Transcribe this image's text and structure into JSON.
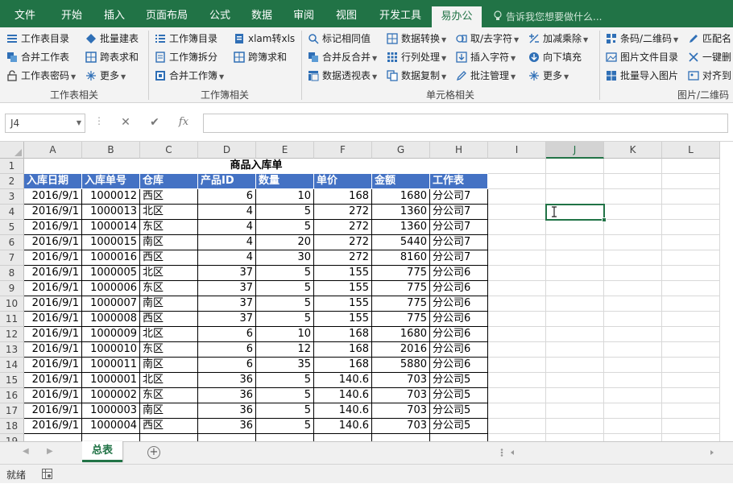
{
  "tabs": [
    "文件",
    "开始",
    "插入",
    "页面布局",
    "公式",
    "数据",
    "审阅",
    "视图",
    "开发工具",
    "易办公"
  ],
  "active_tab_index": 9,
  "tell_me": "告诉我您想要做什么...",
  "ribbon": {
    "group1": {
      "label": "工作表相关",
      "items": [
        "工作表目录",
        "批量建表",
        "合并工作表",
        "跨表求和",
        "工作表密码",
        "更多"
      ]
    },
    "group2": {
      "label": "工作簿相关",
      "items": [
        "工作簿目录",
        "xlam转xls",
        "工作簿拆分",
        "跨簿求和",
        "合并工作簿"
      ]
    },
    "group3": {
      "label": "单元格相关",
      "items": [
        "标记相同值",
        "数据转换",
        "取/去字符",
        "加减乘除",
        "合并反合并",
        "行列处理",
        "插入字符",
        "向下填充",
        "数据透视表",
        "数据复制",
        "批注管理",
        "更多"
      ]
    },
    "group4": {
      "label": "图片/二维码",
      "items": [
        "条码/二维码",
        "匹配名",
        "图片文件目录",
        "一键删",
        "批量导入图片",
        "对齐到"
      ]
    }
  },
  "formula_bar": {
    "name_box": "J4",
    "formula": ""
  },
  "columns": [
    "A",
    "B",
    "C",
    "D",
    "E",
    "F",
    "G",
    "H",
    "I",
    "J",
    "K",
    "L"
  ],
  "selected_column": "J",
  "title": "商品入库单",
  "headers": [
    "入库日期",
    "入库单号",
    "仓库",
    "产品ID",
    "数量",
    "单价",
    "金额",
    "工作表"
  ],
  "rows": [
    [
      "2016/9/1",
      "1000012",
      "西区",
      "6",
      "10",
      "168",
      "1680",
      "分公司7"
    ],
    [
      "2016/9/1",
      "1000013",
      "北区",
      "4",
      "5",
      "272",
      "1360",
      "分公司7"
    ],
    [
      "2016/9/1",
      "1000014",
      "东区",
      "4",
      "5",
      "272",
      "1360",
      "分公司7"
    ],
    [
      "2016/9/1",
      "1000015",
      "南区",
      "4",
      "20",
      "272",
      "5440",
      "分公司7"
    ],
    [
      "2016/9/1",
      "1000016",
      "西区",
      "4",
      "30",
      "272",
      "8160",
      "分公司7"
    ],
    [
      "2016/9/1",
      "1000005",
      "北区",
      "37",
      "5",
      "155",
      "775",
      "分公司6"
    ],
    [
      "2016/9/1",
      "1000006",
      "东区",
      "37",
      "5",
      "155",
      "775",
      "分公司6"
    ],
    [
      "2016/9/1",
      "1000007",
      "南区",
      "37",
      "5",
      "155",
      "775",
      "分公司6"
    ],
    [
      "2016/9/1",
      "1000008",
      "西区",
      "37",
      "5",
      "155",
      "775",
      "分公司6"
    ],
    [
      "2016/9/1",
      "1000009",
      "北区",
      "6",
      "10",
      "168",
      "1680",
      "分公司6"
    ],
    [
      "2016/9/1",
      "1000010",
      "东区",
      "6",
      "12",
      "168",
      "2016",
      "分公司6"
    ],
    [
      "2016/9/1",
      "1000011",
      "南区",
      "6",
      "35",
      "168",
      "5880",
      "分公司6"
    ],
    [
      "2016/9/1",
      "1000001",
      "北区",
      "36",
      "5",
      "140.6",
      "703",
      "分公司5"
    ],
    [
      "2016/9/1",
      "1000002",
      "东区",
      "36",
      "5",
      "140.6",
      "703",
      "分公司5"
    ],
    [
      "2016/9/1",
      "1000003",
      "南区",
      "36",
      "5",
      "140.6",
      "703",
      "分公司5"
    ],
    [
      "2016/9/1",
      "1000004",
      "西区",
      "36",
      "5",
      "140.6",
      "703",
      "分公司5"
    ]
  ],
  "sheet_tab": "总表",
  "status": "就绪",
  "colors": {
    "accent": "#217346",
    "header_fill": "#4472c4"
  }
}
